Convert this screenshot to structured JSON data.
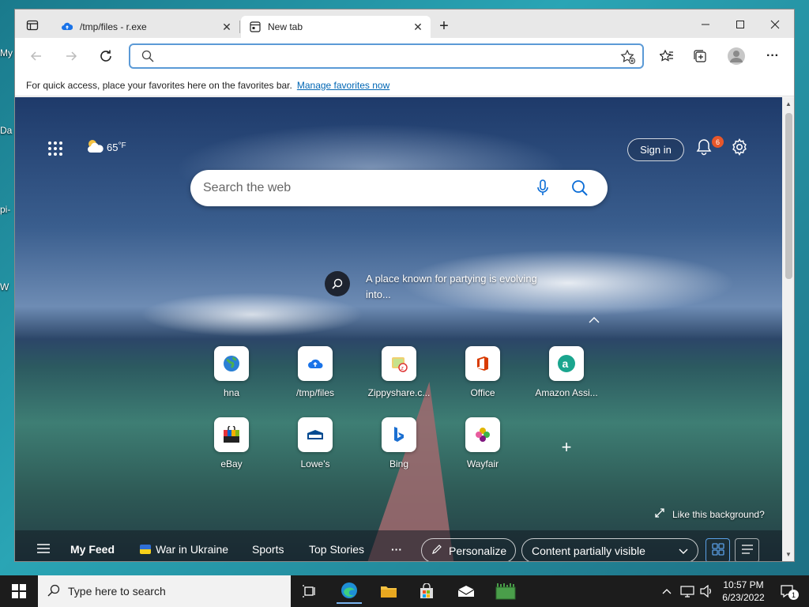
{
  "desktop": {
    "labels": [
      "My",
      "Da",
      "pi-",
      "W"
    ]
  },
  "browser": {
    "tabs": [
      {
        "title": "/tmp/files - r.exe",
        "icon": "cloud-upload-icon",
        "active": false
      },
      {
        "title": "New tab",
        "icon": "newtab-icon",
        "active": true
      }
    ],
    "address": {
      "value": "",
      "placeholder": ""
    },
    "favorites_bar": {
      "message": "For quick access, place your favorites here on the favorites bar.",
      "link": "Manage favorites now"
    }
  },
  "newtab": {
    "weather": {
      "temp": "65",
      "unit": "°F"
    },
    "sign_in": "Sign in",
    "notification_count": "6",
    "search": {
      "placeholder": "Search the web"
    },
    "headline": "A place known for partying is evolving into...",
    "tiles": [
      {
        "label": "hna",
        "icon": "globe-icon"
      },
      {
        "label": "/tmp/files",
        "icon": "cloud-upload-icon"
      },
      {
        "label": "Zippyshare.c...",
        "icon": "zippyshare-icon"
      },
      {
        "label": "Office",
        "icon": "office-icon"
      },
      {
        "label": "Amazon Assi...",
        "icon": "amazon-assistant-icon"
      },
      {
        "label": "eBay",
        "icon": "ebay-icon"
      },
      {
        "label": "Lowe's",
        "icon": "lowes-icon"
      },
      {
        "label": "Bing",
        "icon": "bing-icon"
      },
      {
        "label": "Wayfair",
        "icon": "wayfair-icon"
      }
    ],
    "like_background": "Like this background?",
    "feed": {
      "my_feed": "My Feed",
      "items": [
        "War in Ukraine",
        "Sports",
        "Top Stories"
      ],
      "more": "···",
      "personalize": "Personalize",
      "content_select": "Content partially visible"
    }
  },
  "taskbar": {
    "search_placeholder": "Type here to search",
    "time": "10:57 PM",
    "date": "6/23/2022",
    "notification_count": "1"
  },
  "colors": {
    "accent": "#0066b4",
    "badge": "#e8572a",
    "taskbar": "#1c1c1c"
  }
}
